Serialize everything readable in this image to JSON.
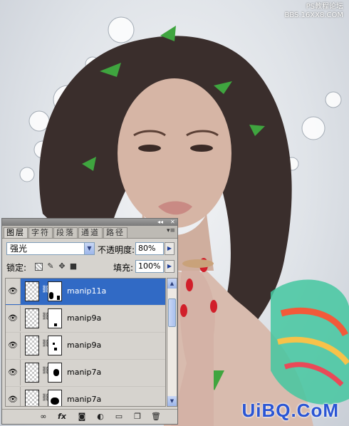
{
  "watermark": {
    "line1": "PS教程论坛",
    "line2": "BBS.16XX8.COM",
    "brand": "UiBQ.CoM"
  },
  "panel": {
    "tabs": [
      "图层",
      "字符",
      "段落",
      "通道",
      "路径"
    ],
    "blend_mode": "强光",
    "opacity_label": "不透明度:",
    "opacity_value": "80%",
    "lock_label": "锁定:",
    "fill_label": "填充:",
    "fill_value": "100%",
    "layers": [
      {
        "name": "manip11a",
        "selected": true
      },
      {
        "name": "manip9a",
        "selected": false
      },
      {
        "name": "manip9a",
        "selected": false
      },
      {
        "name": "manip7a",
        "selected": false
      },
      {
        "name": "manip7a",
        "selected": false
      }
    ],
    "footer_icons": [
      "link-icon",
      "fx-icon",
      "mask-icon",
      "adjustment-icon",
      "group-folder-icon",
      "new-layer-icon",
      "trash-icon"
    ]
  },
  "colors": {
    "selection": "#316ac5",
    "brand": "#2a55d4",
    "panel_bg": "#d6d3ce"
  }
}
